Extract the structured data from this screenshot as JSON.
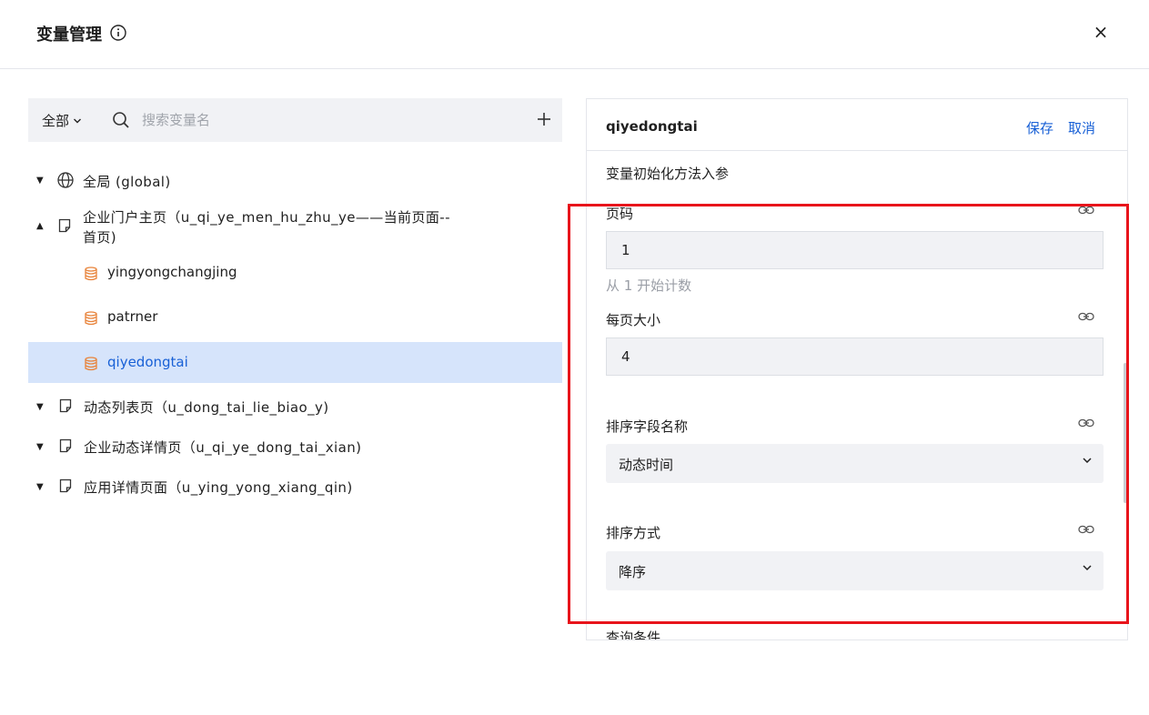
{
  "dialog": {
    "title": "变量管理",
    "close_symbol": "×"
  },
  "left": {
    "scope_select": "全部",
    "search_placeholder": "搜索变量名",
    "tree": [
      {
        "label": "全局 (global)",
        "caret": "▼"
      },
      {
        "label": "企业门户主页（u_qi_ye_men_hu_zhu_ye——当前页面--",
        "label_line2": "首页)",
        "caret": "▲"
      },
      {
        "label": "yingyongchangjing"
      },
      {
        "label": "patrner"
      },
      {
        "label": "qiyedongtai"
      },
      {
        "label": "动态列表页（u_dong_tai_lie_biao_y)",
        "caret": "▼"
      },
      {
        "label": "企业动态详情页（u_qi_ye_dong_tai_xian)",
        "caret": "▼"
      },
      {
        "label": "应用详情页面（u_ying_yong_xiang_qin)",
        "caret": "▼"
      }
    ]
  },
  "detail": {
    "name": "qiyedongtai",
    "save_label": "保存",
    "cancel_label": "取消",
    "section_title": "变量初始化方法入参",
    "fields": {
      "page_no": {
        "label": "页码",
        "value": "1",
        "hint": "从 1 开始计数"
      },
      "page_size": {
        "label": "每页大小",
        "value": "4"
      },
      "sort_field": {
        "label": "排序字段名称",
        "value": "动态时间"
      },
      "sort_order": {
        "label": "排序方式",
        "value": "降序"
      }
    },
    "cut_label": "查询条件"
  },
  "colors": {
    "accent": "#1860d6",
    "highlight": "#e8141b",
    "selected_bg": "#d6e4fb",
    "db_icon": "#e8833a"
  }
}
